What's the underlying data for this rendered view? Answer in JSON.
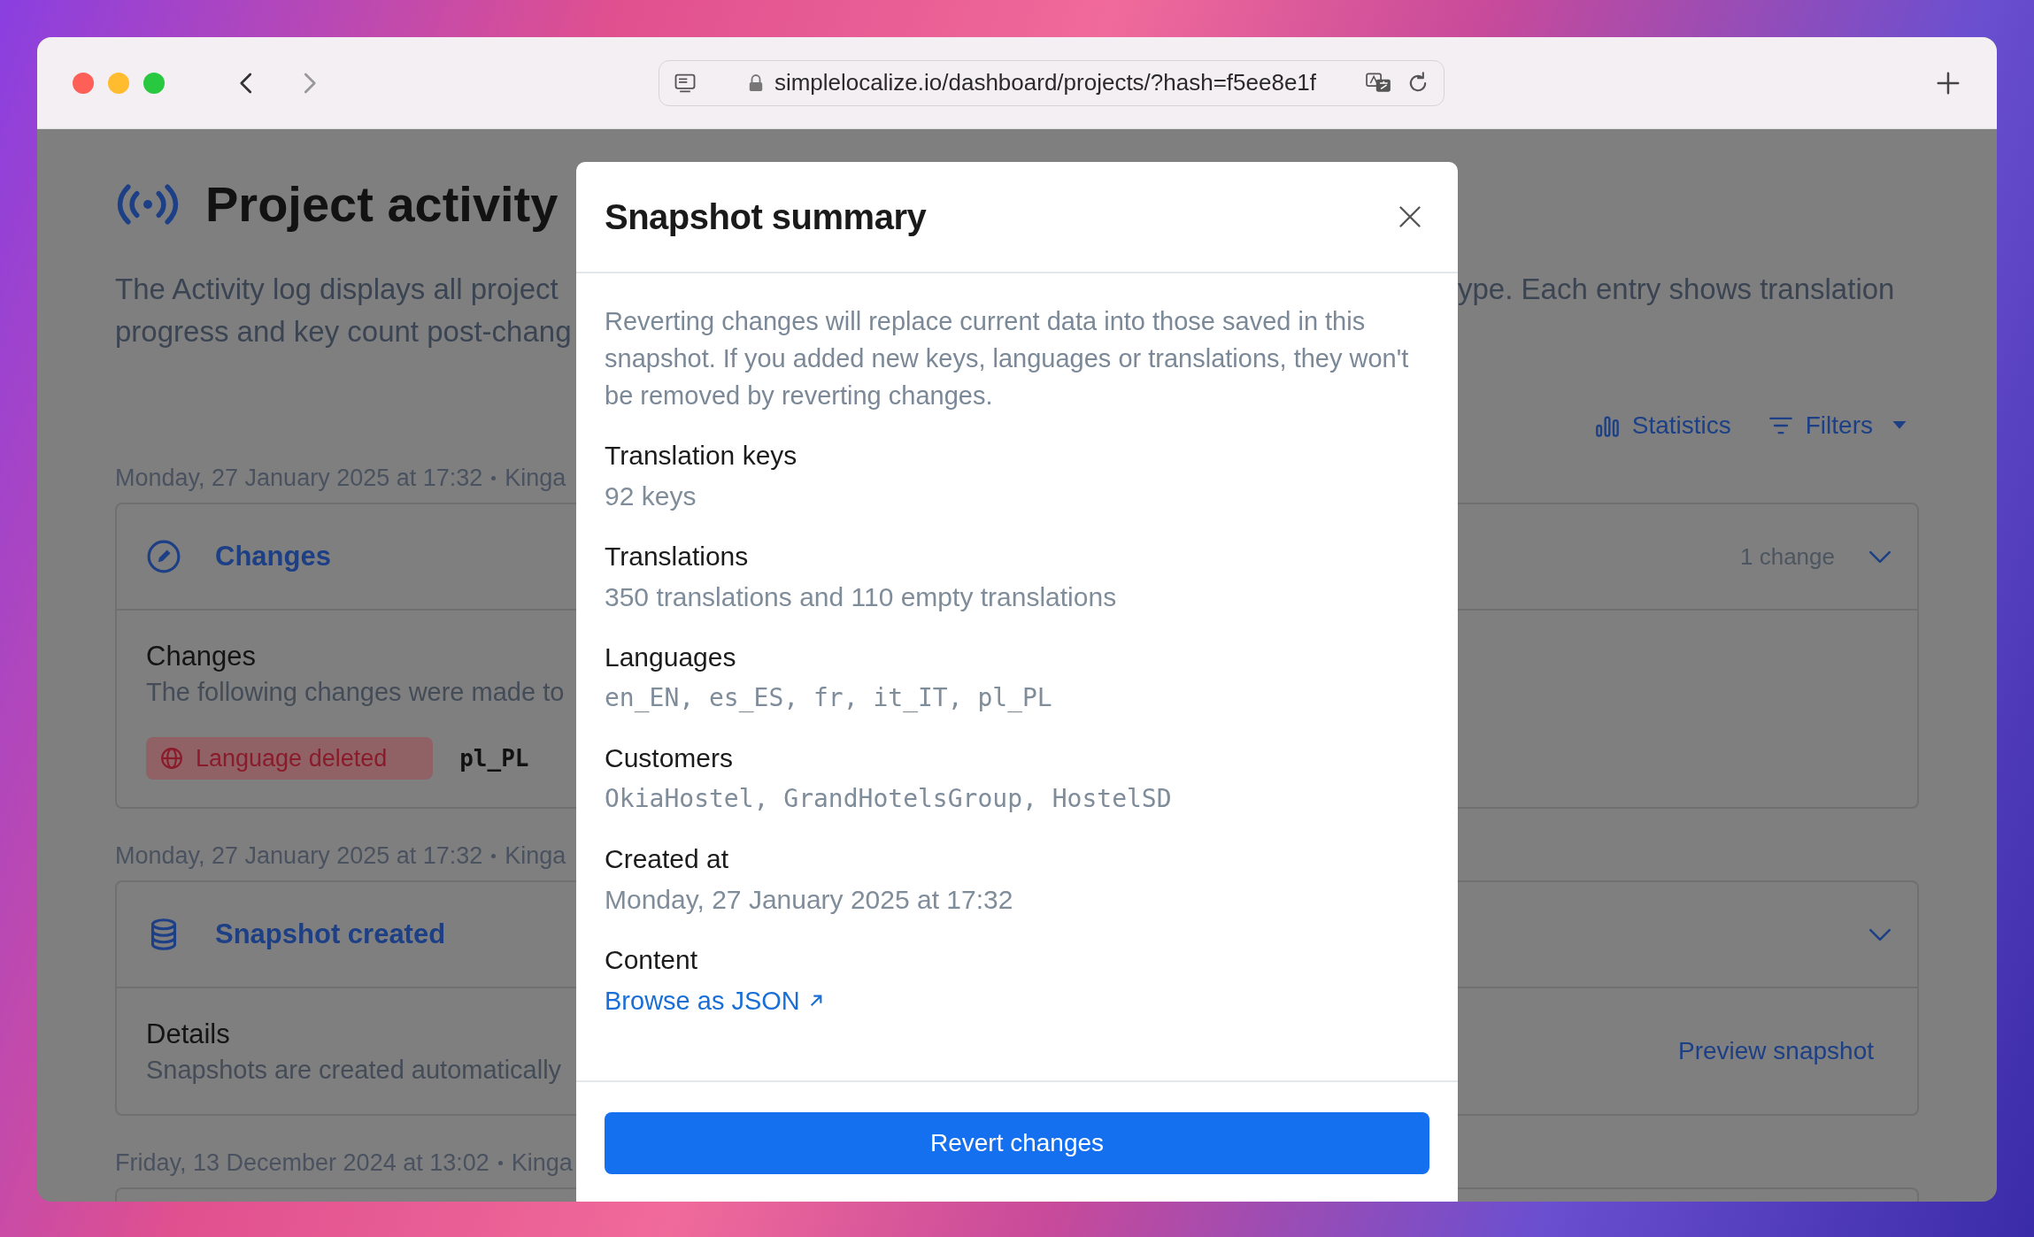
{
  "browser": {
    "url": "simplelocalize.io/dashboard/projects/?hash=f5ee8e1f"
  },
  "page": {
    "title": "Project activity",
    "description": {
      "left": [
        "The Activity log displays all project",
        "progress and key count post-chang"
      ],
      "right": [
        "ype. Each entry shows translation"
      ]
    },
    "actions": [
      {
        "label": "Statistics",
        "kind": "stats"
      },
      {
        "label": "Filters",
        "kind": "filter"
      }
    ],
    "entries": [
      {
        "date": "Monday, 27 January 2025 at 17:32",
        "author": "Kinga",
        "kind": "changes",
        "title": "Changes",
        "summary": "1 change",
        "expanded": true,
        "heading": "Changes",
        "text": "The following changes were made to",
        "badge": "Language deleted",
        "value": "pl_PL"
      },
      {
        "date": "Monday, 27 January 2025 at 17:32",
        "author": "Kinga",
        "kind": "snapshot",
        "title": "Snapshot created",
        "expanded": true,
        "heading": "Details",
        "text": "Snapshots are created automatically",
        "action": "Preview snapshot"
      },
      {
        "date": "Friday, 13 December 2024 at 13:02",
        "author": "Kinga"
      }
    ]
  },
  "modal": {
    "title": "Snapshot summary",
    "intro": "Reverting changes will replace current data into those saved in this snapshot. If you added new keys, languages or translations, they won't be removed by reverting changes.",
    "fields": [
      {
        "label": "Translation keys",
        "value": "92 keys",
        "kind": "text"
      },
      {
        "label": "Translations",
        "value": "350 translations and 110 empty translations",
        "kind": "text"
      },
      {
        "label": "Languages",
        "value": "en_EN, es_ES, fr, it_IT, pl_PL",
        "kind": "mono"
      },
      {
        "label": "Customers",
        "value": "OkiaHostel, GrandHotelsGroup, HostelSD",
        "kind": "mono"
      },
      {
        "label": "Created at",
        "value": "Monday, 27 January 2025 at 17:32",
        "kind": "text"
      },
      {
        "label": "Content",
        "value": "Browse as JSON",
        "kind": "link"
      }
    ],
    "button": "Revert changes"
  }
}
